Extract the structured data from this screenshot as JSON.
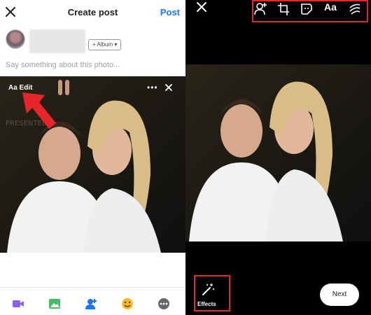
{
  "left": {
    "header": {
      "title": "Create post",
      "post_label": "Post"
    },
    "album_label": "+ Album ▾",
    "caption_placeholder": "Say something about this photo...",
    "photo": {
      "edit_label": "Aa Edit",
      "more_label": "•••"
    }
  },
  "right": {
    "toolbar_aa": "Aa",
    "effects_label": "Effects",
    "next_label": "Next"
  },
  "colors": {
    "accent": "#1877f2",
    "highlight": "#e02b2b",
    "bg_editor": "#000000"
  },
  "icons": [
    "close-icon",
    "more-icon",
    "video-icon",
    "photo-icon",
    "tag-people-icon",
    "emoji-icon",
    "more-options-icon",
    "tag-person-icon",
    "crop-icon",
    "sticker-icon",
    "text-icon",
    "draw-icon",
    "effects-wand-icon"
  ]
}
